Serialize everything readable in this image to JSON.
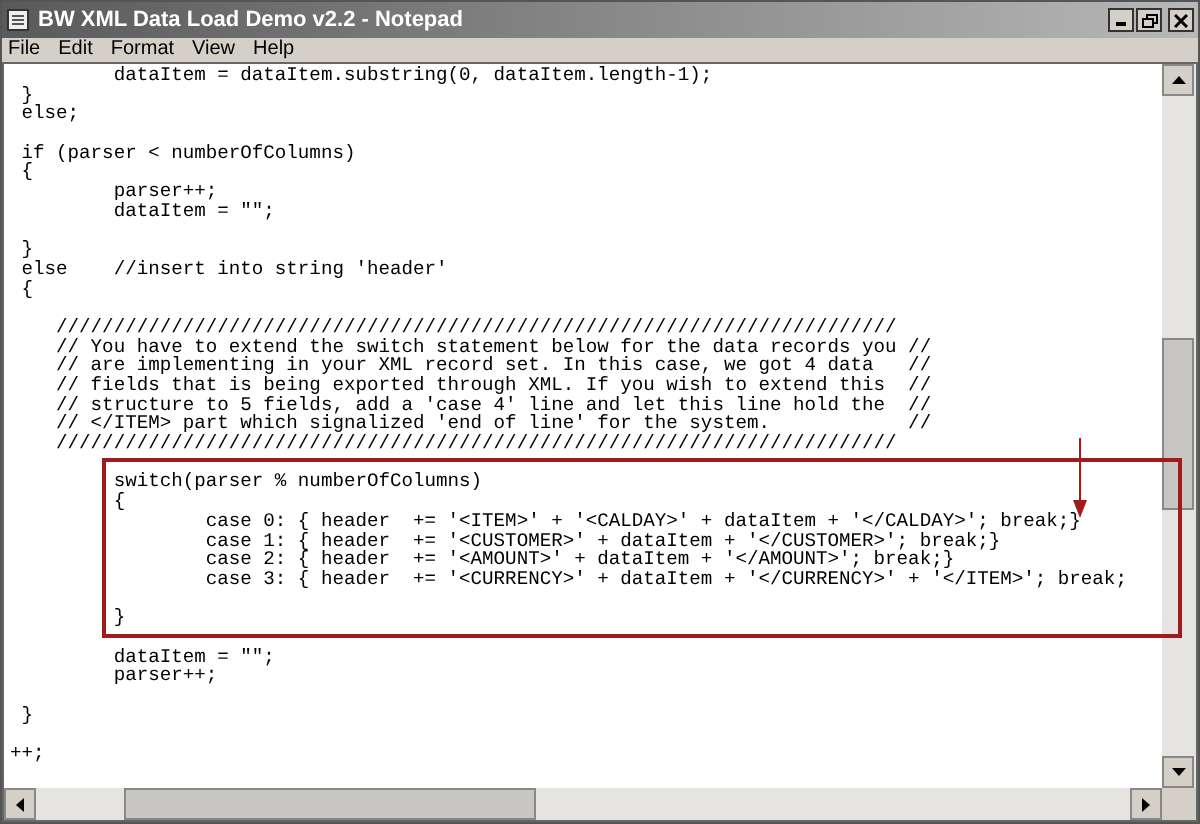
{
  "window": {
    "title": "BW XML Data Load Demo v2.2 - Notepad"
  },
  "menu": [
    {
      "label": "File"
    },
    {
      "label": "Edit"
    },
    {
      "label": "Format"
    },
    {
      "label": "View"
    },
    {
      "label": "Help"
    }
  ],
  "paragraphs": [
    {
      "lines": [
        "         dataItem = dataItem.substring(0, dataItem.length-1);",
        " }",
        " else;"
      ]
    },
    {
      "lines": [
        " if (parser < numberOfColumns)",
        " {",
        "         parser++;",
        "         dataItem = \"\";"
      ]
    },
    {
      "lines": [
        " }",
        " else    //insert into string 'header'",
        " {"
      ]
    },
    {
      "lines": [
        "    /////////////////////////////////////////////////////////////////////////",
        "    // You have to extend the switch statement below for the data records you //",
        "    // are implementing in your XML record set. In this case, we got 4 data   //",
        "    // fields that is being exported through XML. If you wish to extend this  //",
        "    // structure to 5 fields, add a 'case 4' line and let this line hold the  //",
        "    // </ITEM> part which signalized 'end of line' for the system.            //",
        "    /////////////////////////////////////////////////////////////////////////"
      ]
    },
    {
      "lines": [
        "         switch(parser % numberOfColumns)",
        "         {",
        "                 case 0: { header  += '<ITEM>' + '<CALDAY>' + dataItem + '</CALDAY>'; break;}",
        "                 case 1: { header  += '<CUSTOMER>' + dataItem + '</CUSTOMER>'; break;}",
        "                 case 2: { header  += '<AMOUNT>' + dataItem + '</AMOUNT>'; break;}",
        "                 case 3: { header  += '<CURRENCY>' + dataItem + '</CURRENCY>' + '</ITEM>'; break;"
      ]
    },
    {
      "lines": [
        "         }"
      ]
    },
    {
      "lines": [
        "         dataItem = \"\";",
        "         parser++;"
      ]
    },
    {
      "lines": [
        " }"
      ]
    },
    {
      "lines": [
        "++;"
      ]
    }
  ]
}
